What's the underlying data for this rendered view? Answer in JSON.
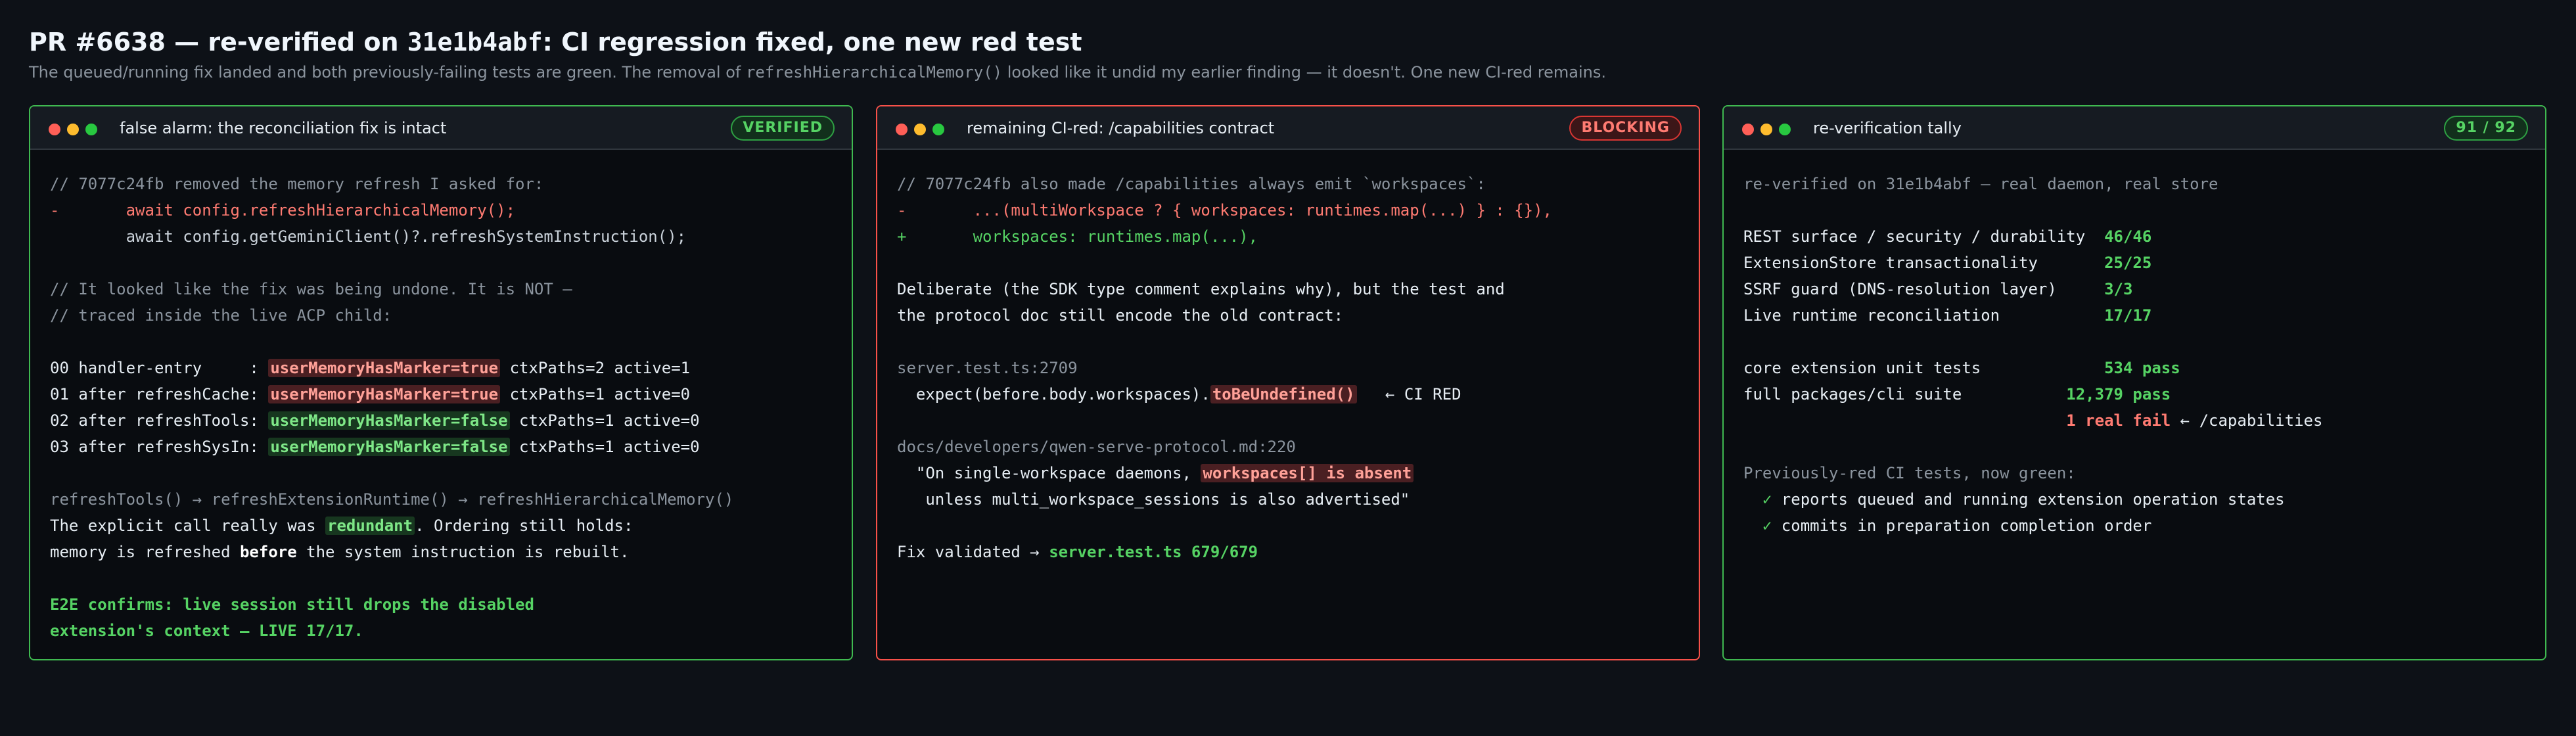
{
  "header": {
    "title_prefix": "PR #6638 — re-verified on ",
    "title_hash": "31e1b4abf",
    "title_suffix": ": CI regression fixed, one new red test",
    "subtitle_prefix": "The queued/running fix landed and both previously-failing tests are green. The removal of ",
    "subtitle_code": "refreshHierarchicalMemory()",
    "subtitle_suffix": " looked like it undid my earlier finding — it doesn't. One new CI-red remains."
  },
  "panels": {
    "reconciliation": {
      "title": "false alarm: the reconciliation fix is intact",
      "badge": "VERIFIED",
      "lines": {
        "l1": "// 7077c24fb removed the memory refresh I asked for:",
        "l2": "-       await config.refreshHierarchicalMemory();",
        "l3": "        await config.getGeminiClient()?.refreshSystemInstruction();",
        "l4": "// It looked like the fix was being undone. It is NOT —",
        "l5": "// traced inside the live ACP child:",
        "t1_pre": "00 handler-entry     : ",
        "t1_hl": "userMemoryHasMarker=true",
        "t1_post": " ctxPaths=2 active=1",
        "t2_pre": "01 after refreshCache: ",
        "t2_hl": "userMemoryHasMarker=true",
        "t2_post": " ctxPaths=1 active=0",
        "t3_pre": "02 after refreshTools: ",
        "t3_hl": "userMemoryHasMarker=false",
        "t3_post": " ctxPaths=1 active=0",
        "t4_pre": "03 after refreshSysIn: ",
        "t4_hl": "userMemoryHasMarker=false",
        "t4_post": " ctxPaths=1 active=0",
        "chain": "refreshTools() → refreshExtensionRuntime() → refreshHierarchicalMemory()",
        "e1_pre": "The explicit call really was ",
        "e1_hl": "redundant",
        "e1_post": ". Ordering still holds:",
        "e2_pre": "memory is refreshed ",
        "e2_bold": "before",
        "e2_post": " the system instruction is rebuilt.",
        "e2e1": "E2E confirms: live session still drops the disabled",
        "e2e2": "extension's context — LIVE 17/17."
      }
    },
    "capabilities": {
      "title": "remaining CI-red: /capabilities contract",
      "badge": "BLOCKING",
      "lines": {
        "l1": "// 7077c24fb also made /capabilities always emit `workspaces`:",
        "l2": "-       ...(multiWorkspace ? { workspaces: runtimes.map(...) } : {}),",
        "l3": "+       workspaces: runtimes.map(...),",
        "l4": "Deliberate (the SDK type comment explains why), but the test and",
        "l5": "the protocol doc still encode the old contract:",
        "l6": "server.test.ts:2709",
        "l7_pre": "  expect(before.body.workspaces).",
        "l7_hl": "toBeUndefined()",
        "l7_post": "   ← CI RED",
        "l8": "docs/developers/qwen-serve-protocol.md:220",
        "l9_pre": "  \"On single-workspace daemons, ",
        "l9_hl": "workspaces[] is absent",
        "l10": "   unless multi_workspace_sessions is also advertised\"",
        "l11_pre": "Fix validated → ",
        "l11_green": "server.test.ts 679/679"
      }
    },
    "tally": {
      "title": "re-verification tally",
      "badge": "91 / 92",
      "lines": {
        "intro": "re-verified on 31e1b4abf — real daemon, real store",
        "r1_label": "REST surface / security / durability  ",
        "r1_val": "46/46",
        "r2_label": "ExtensionStore transactionality       ",
        "r2_val": "25/25",
        "r3_label": "SSRF guard (DNS-resolution layer)     ",
        "r3_val": "3/3",
        "r4_label": "Live runtime reconciliation           ",
        "r4_val": "17/17",
        "u1_label": "core extension unit tests             ",
        "u1_val": "534 pass",
        "u2_label": "full packages/cli suite           ",
        "u2_val": "12,379 pass",
        "u3_pad": "                                  ",
        "u3_val": "1 real fail",
        "u3_post": " ← /capabilities",
        "prev": "Previously-red CI tests, now green:",
        "check": "✓",
        "p1": " reports queued and running extension operation states",
        "p2": " commits in preparation completion order"
      }
    }
  },
  "colors": {
    "background": "#0d1117",
    "verified": "#3fb950",
    "blocking": "#f85149"
  }
}
